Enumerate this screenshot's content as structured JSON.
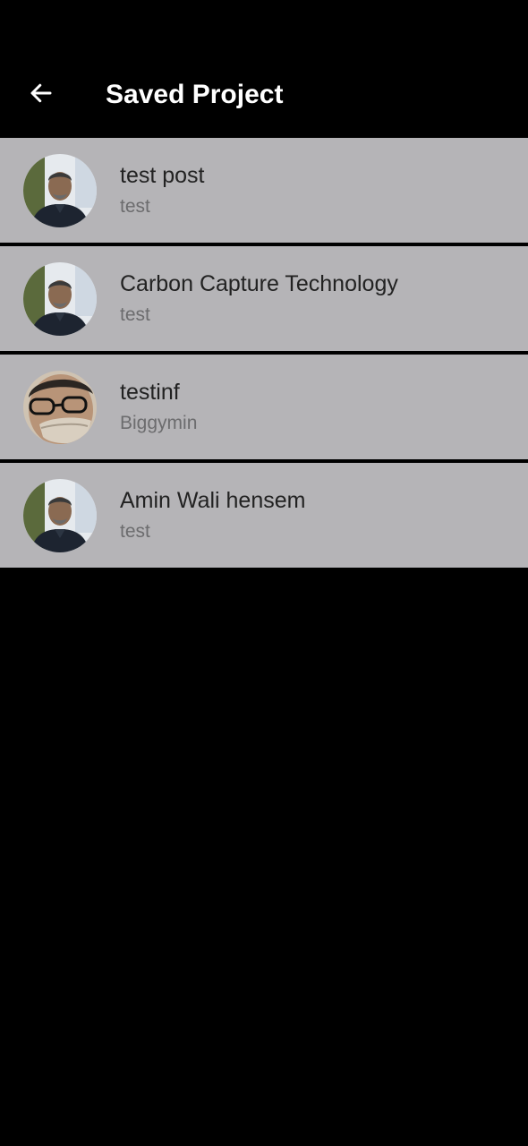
{
  "header": {
    "title": "Saved Project",
    "back_icon": "arrow-left-icon"
  },
  "colors": {
    "background": "#000000",
    "list_item_background": "#b5b4b7",
    "title_text": "#222222",
    "subtitle_text": "#6c6c6e",
    "header_text": "#ffffff"
  },
  "projects": [
    {
      "title": "test post",
      "subtitle": "test",
      "avatar": "man-portrait-avatar"
    },
    {
      "title": "Carbon Capture Technology",
      "subtitle": "test",
      "avatar": "man-portrait-avatar"
    },
    {
      "title": "testinf",
      "subtitle": "Biggymin",
      "avatar": "glasses-selfie-avatar"
    },
    {
      "title": "Amin Wali hensem",
      "subtitle": "test",
      "avatar": "man-portrait-avatar"
    }
  ]
}
